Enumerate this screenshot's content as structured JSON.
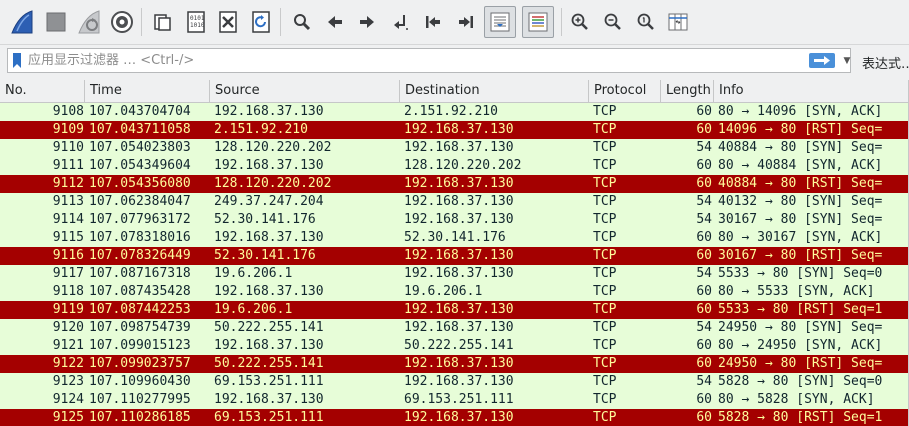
{
  "toolbar": {
    "buttons": [
      {
        "name": "start-capture-button",
        "icon": "shark-fin-icon"
      },
      {
        "name": "stop-capture-button",
        "icon": "stop-square-icon"
      },
      {
        "name": "restart-capture-button",
        "icon": "shark-fin-restart-icon"
      },
      {
        "name": "capture-options-button",
        "icon": "gear-icon"
      },
      {
        "name": "open-file-button",
        "icon": "folder-icon"
      },
      {
        "name": "save-file-button",
        "icon": "binary-file-icon"
      },
      {
        "name": "close-file-button",
        "icon": "file-close-icon"
      },
      {
        "name": "reload-file-button",
        "icon": "reload-icon"
      },
      {
        "name": "find-packet-button",
        "icon": "magnifier-icon"
      },
      {
        "name": "go-back-button",
        "icon": "arrow-left-icon"
      },
      {
        "name": "go-forward-button",
        "icon": "arrow-right-icon"
      },
      {
        "name": "go-to-packet-button",
        "icon": "jump-arrow-icon"
      },
      {
        "name": "go-first-packet-button",
        "icon": "first-packet-icon"
      },
      {
        "name": "go-last-packet-button",
        "icon": "last-packet-icon"
      },
      {
        "name": "auto-scroll-button",
        "icon": "auto-scroll-icon"
      },
      {
        "name": "colorize-button",
        "icon": "colorize-lines-icon"
      },
      {
        "name": "zoom-in-button",
        "icon": "zoom-in-icon"
      },
      {
        "name": "zoom-out-button",
        "icon": "zoom-out-icon"
      },
      {
        "name": "zoom-normal-button",
        "icon": "zoom-normal-icon"
      },
      {
        "name": "resize-columns-button",
        "icon": "resize-columns-icon"
      }
    ]
  },
  "filter": {
    "placeholder": "应用显示过滤器 … <Ctrl-/>",
    "value": "",
    "expression_label": "表达式…",
    "bookmark_icon": "bookmark-icon",
    "apply_icon": "arrow-right-icon",
    "dropdown_icon": "chevron-down-icon"
  },
  "columns": {
    "no": "No.",
    "time": "Time",
    "source": "Source",
    "destination": "Destination",
    "protocol": "Protocol",
    "length": "Length",
    "info": "Info"
  },
  "colors": {
    "normal_bg": "#e7fdd8",
    "normal_fg": "#12272e",
    "rst_bg": "#a40000",
    "rst_fg": "#fffc9c"
  },
  "packets": [
    {
      "no": "9108",
      "time": "107.043704704",
      "source": "192.168.37.130",
      "destination": "2.151.92.210",
      "protocol": "TCP",
      "length": "60",
      "info": "80 → 14096 [SYN, ACK]",
      "style": "ok"
    },
    {
      "no": "9109",
      "time": "107.043711058",
      "source": "2.151.92.210",
      "destination": "192.168.37.130",
      "protocol": "TCP",
      "length": "60",
      "info": "14096 → 80 [RST] Seq=",
      "style": "rst"
    },
    {
      "no": "9110",
      "time": "107.054023803",
      "source": "128.120.220.202",
      "destination": "192.168.37.130",
      "protocol": "TCP",
      "length": "54",
      "info": "40884 → 80 [SYN] Seq=",
      "style": "ok"
    },
    {
      "no": "9111",
      "time": "107.054349604",
      "source": "192.168.37.130",
      "destination": "128.120.220.202",
      "protocol": "TCP",
      "length": "60",
      "info": "80 → 40884 [SYN, ACK]",
      "style": "ok"
    },
    {
      "no": "9112",
      "time": "107.054356080",
      "source": "128.120.220.202",
      "destination": "192.168.37.130",
      "protocol": "TCP",
      "length": "60",
      "info": "40884 → 80 [RST] Seq=",
      "style": "rst"
    },
    {
      "no": "9113",
      "time": "107.062384047",
      "source": "249.37.247.204",
      "destination": "192.168.37.130",
      "protocol": "TCP",
      "length": "54",
      "info": "40132 → 80 [SYN] Seq=",
      "style": "ok"
    },
    {
      "no": "9114",
      "time": "107.077963172",
      "source": "52.30.141.176",
      "destination": "192.168.37.130",
      "protocol": "TCP",
      "length": "54",
      "info": "30167 → 80 [SYN] Seq=",
      "style": "ok"
    },
    {
      "no": "9115",
      "time": "107.078318016",
      "source": "192.168.37.130",
      "destination": "52.30.141.176",
      "protocol": "TCP",
      "length": "60",
      "info": "80 → 30167 [SYN, ACK]",
      "style": "ok"
    },
    {
      "no": "9116",
      "time": "107.078326449",
      "source": "52.30.141.176",
      "destination": "192.168.37.130",
      "protocol": "TCP",
      "length": "60",
      "info": "30167 → 80 [RST] Seq=",
      "style": "rst"
    },
    {
      "no": "9117",
      "time": "107.087167318",
      "source": "19.6.206.1",
      "destination": "192.168.37.130",
      "protocol": "TCP",
      "length": "54",
      "info": "5533 → 80 [SYN] Seq=0",
      "style": "ok"
    },
    {
      "no": "9118",
      "time": "107.087435428",
      "source": "192.168.37.130",
      "destination": "19.6.206.1",
      "protocol": "TCP",
      "length": "60",
      "info": "80 → 5533 [SYN, ACK]",
      "style": "ok"
    },
    {
      "no": "9119",
      "time": "107.087442253",
      "source": "19.6.206.1",
      "destination": "192.168.37.130",
      "protocol": "TCP",
      "length": "60",
      "info": "5533 → 80 [RST] Seq=1",
      "style": "rst"
    },
    {
      "no": "9120",
      "time": "107.098754739",
      "source": "50.222.255.141",
      "destination": "192.168.37.130",
      "protocol": "TCP",
      "length": "54",
      "info": "24950 → 80 [SYN] Seq=",
      "style": "ok"
    },
    {
      "no": "9121",
      "time": "107.099015123",
      "source": "192.168.37.130",
      "destination": "50.222.255.141",
      "protocol": "TCP",
      "length": "60",
      "info": "80 → 24950 [SYN, ACK]",
      "style": "ok"
    },
    {
      "no": "9122",
      "time": "107.099023757",
      "source": "50.222.255.141",
      "destination": "192.168.37.130",
      "protocol": "TCP",
      "length": "60",
      "info": "24950 → 80 [RST] Seq=",
      "style": "rst"
    },
    {
      "no": "9123",
      "time": "107.109960430",
      "source": "69.153.251.111",
      "destination": "192.168.37.130",
      "protocol": "TCP",
      "length": "54",
      "info": "5828 → 80 [SYN] Seq=0",
      "style": "ok"
    },
    {
      "no": "9124",
      "time": "107.110277995",
      "source": "192.168.37.130",
      "destination": "69.153.251.111",
      "protocol": "TCP",
      "length": "60",
      "info": "80 → 5828 [SYN, ACK]",
      "style": "ok"
    },
    {
      "no": "9125",
      "time": "107.110286185",
      "source": "69.153.251.111",
      "destination": "192.168.37.130",
      "protocol": "TCP",
      "length": "60",
      "info": "5828 → 80 [RST] Seq=1",
      "style": "rst"
    }
  ]
}
